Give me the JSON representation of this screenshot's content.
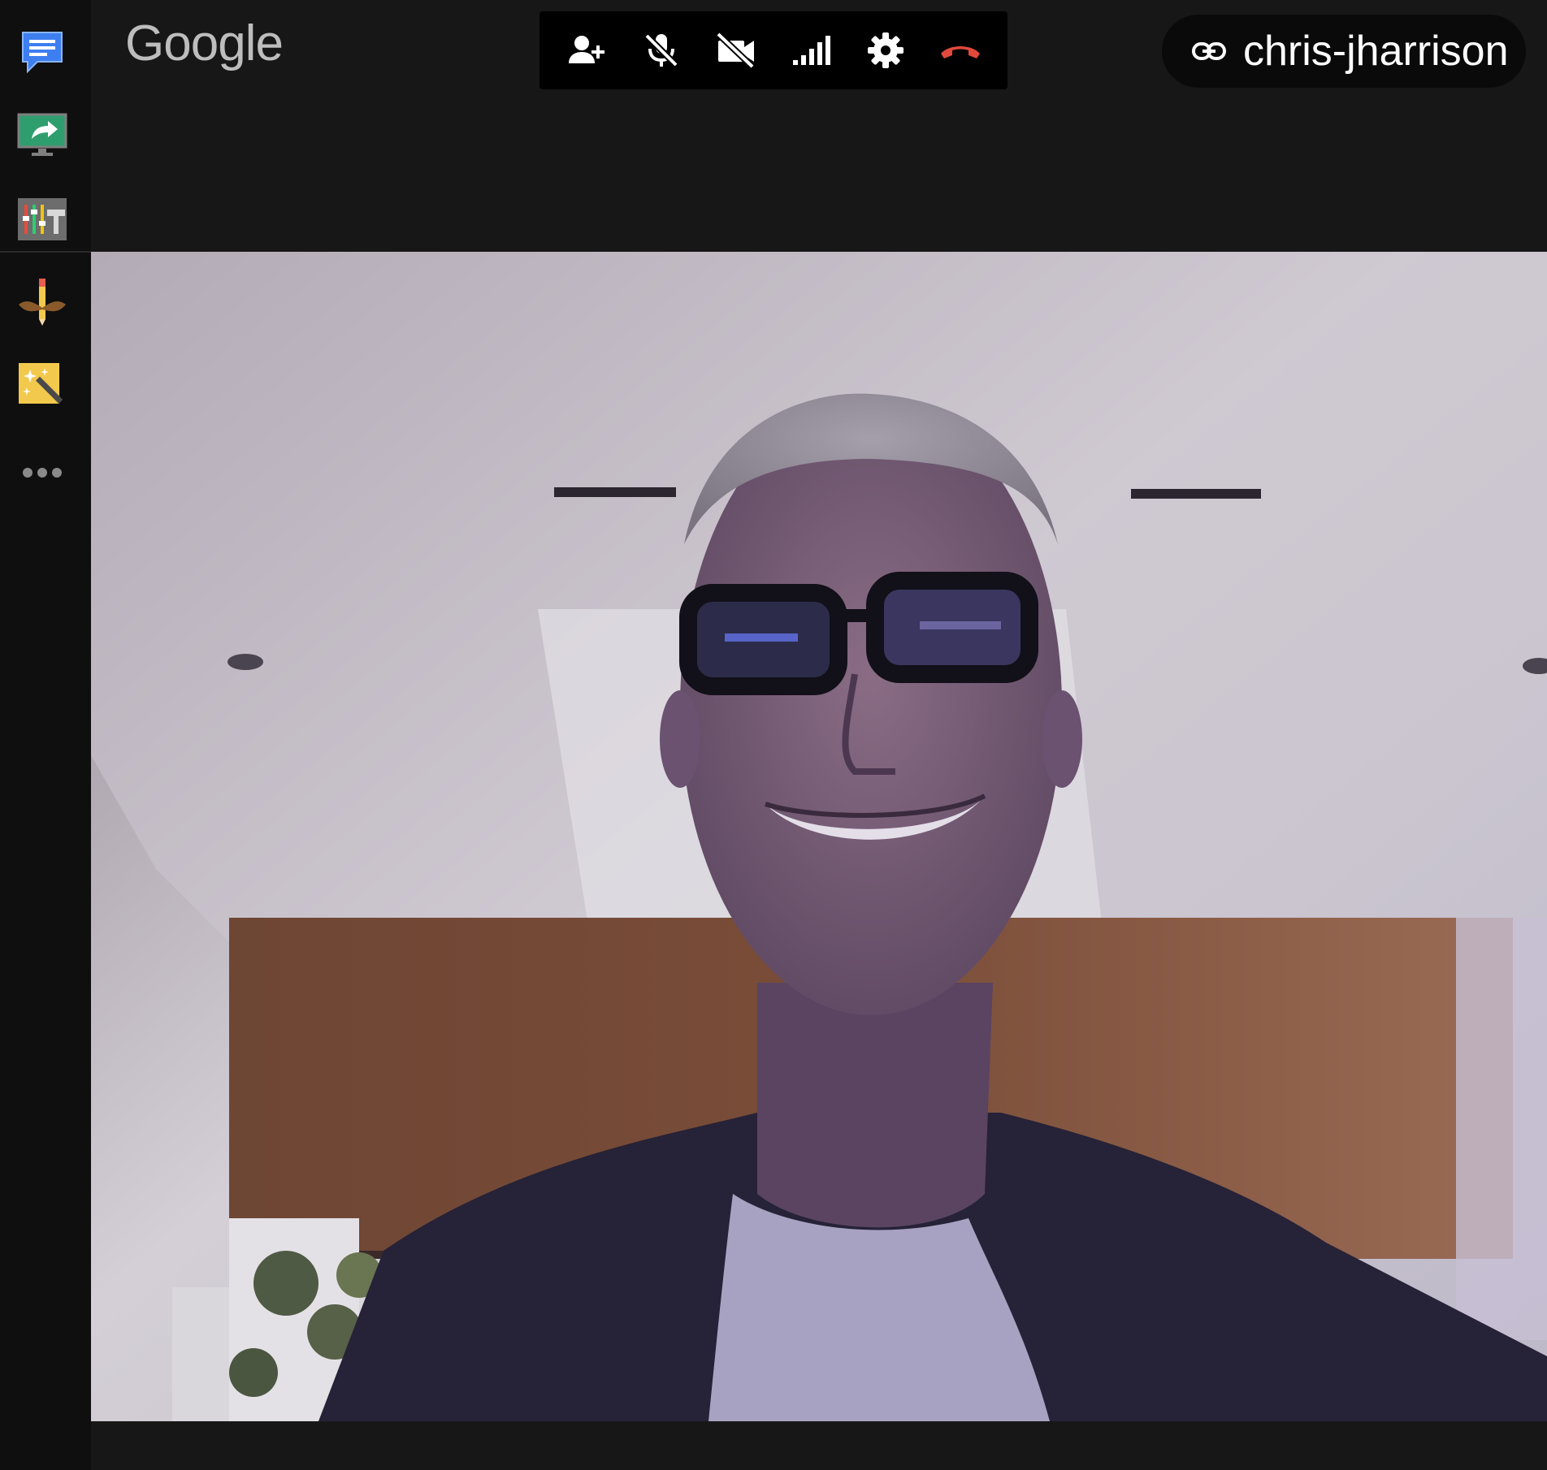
{
  "window": {
    "brand": "Google"
  },
  "sidebar": {
    "tools": [
      {
        "icon": "chat-icon"
      },
      {
        "icon": "present-screen-icon"
      },
      {
        "icon": "equalizer-settings-icon"
      },
      {
        "icon": "mustache-pencil-icon"
      },
      {
        "icon": "magic-wand-effects-icon"
      },
      {
        "icon": "more-horizontal-icon"
      }
    ]
  },
  "controls": [
    {
      "icon": "add-person-icon"
    },
    {
      "icon": "mic-off-icon"
    },
    {
      "icon": "camera-off-icon"
    },
    {
      "icon": "signal-strength-icon"
    },
    {
      "icon": "settings-gear-icon"
    },
    {
      "icon": "hang-up-icon",
      "color": "#e0493c"
    }
  ],
  "meeting": {
    "link_icon": "link-icon",
    "name": "chris-jharrison"
  },
  "video": {
    "subject": "participant camera feed"
  },
  "colors": {
    "background": "#171717",
    "sidebar": "#0f0f0f",
    "control_bar": "#000000",
    "hangup": "#e0493c",
    "chat_blue": "#3d7ef0",
    "present_green": "#2f9e6e",
    "effects_yellow": "#f2c94c"
  }
}
